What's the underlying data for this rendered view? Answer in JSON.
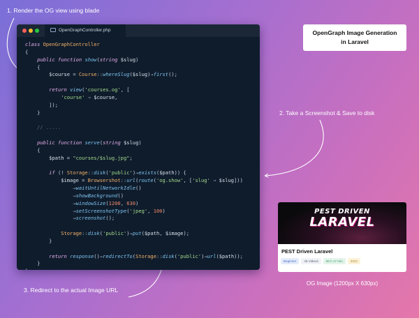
{
  "annotations": {
    "step1": "1. Render the OG view using blade",
    "step2": "2. Take a Screenshot & Save to disk",
    "step3": "3. Redirect to the actual Image URL"
  },
  "title_box": "OpenGraph Image Generation in Laravel",
  "editor": {
    "tab_label": "OpenGraphController.php",
    "code_lines": [
      "class OpenGraphController",
      "{",
      "    public function show(string $slug)",
      "    {",
      "        $course = Course::whereSlug($slug)→first();",
      "",
      "        return view('courses.og', [",
      "            'course' ⇒ $course,",
      "        ]);",
      "    }",
      "",
      "    // .....",
      "",
      "    public function serve(string $slug)",
      "    {",
      "        $path = \"courses/$slug.jpg\";",
      "",
      "        if (! Storage::disk('public')→exists($path)) {",
      "            $image = Browsershot::url(route('og.show', ['slug' ⇒ $slug]))",
      "                →waitUntilNetworkIdle()",
      "                →showBackground()",
      "                →windowSize(1200, 630)",
      "                →setScreenshotType('jpeg', 100)",
      "                →screenshot();",
      "",
      "            Storage::disk('public')→put($path, $image);",
      "        }",
      "",
      "        return response()→redirectTo(Storage::disk('public')→url($path));",
      "    }",
      "}"
    ]
  },
  "og_card": {
    "logo_line1": "PEST DRIVEN",
    "logo_line2": "LARAVEL",
    "title": "PEST Driven Laravel",
    "tags": [
      "Beginner",
      "45 Videos",
      "06 h 17 min",
      "2022"
    ]
  },
  "og_caption": "OG Image (1200px X 630px)"
}
